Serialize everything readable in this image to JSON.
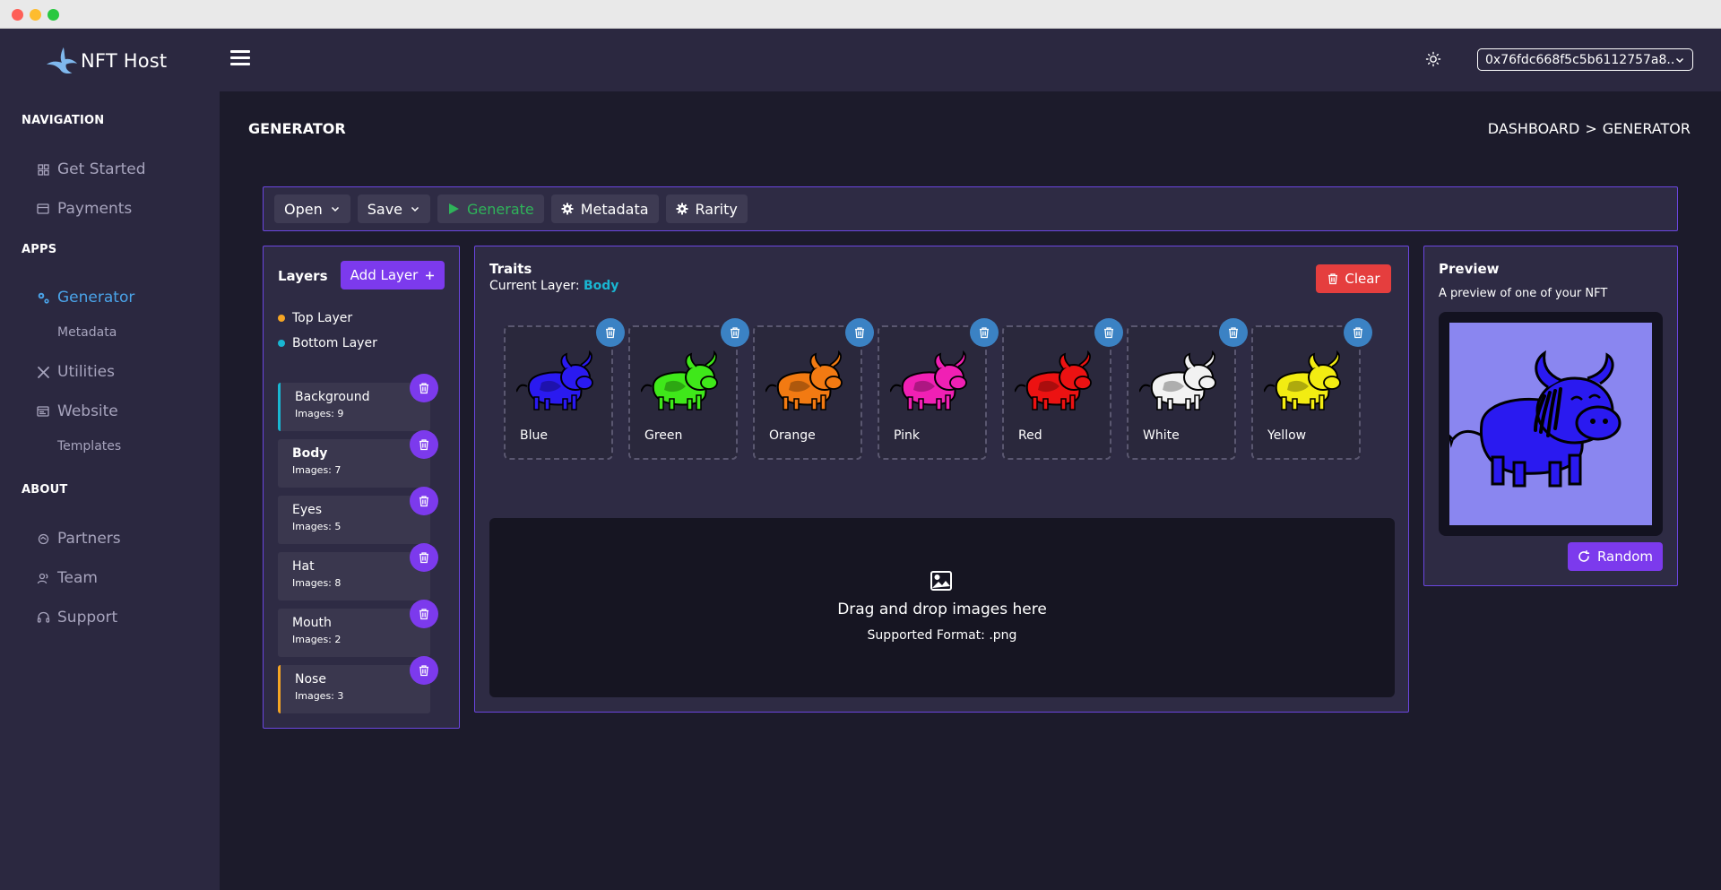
{
  "app": {
    "name": "NFT Host"
  },
  "window": {
    "buttons": [
      "close",
      "minimize",
      "maximize"
    ]
  },
  "sidebar": {
    "sections": {
      "navigation": "NAVIGATION",
      "apps": "APPS",
      "about": "ABOUT"
    },
    "items": {
      "get_started": "Get Started",
      "payments": "Payments",
      "generator": "Generator",
      "metadata": "Metadata",
      "utilities": "Utilities",
      "website": "Website",
      "templates": "Templates",
      "partners": "Partners",
      "team": "Team",
      "support": "Support"
    },
    "active_item": "Generator"
  },
  "topbar": {
    "wallet": "0x76fdc668f5c5b6112757a8..."
  },
  "header": {
    "title": "GENERATOR",
    "breadcrumb": [
      "DASHBOARD",
      ">",
      "GENERATOR"
    ]
  },
  "toolbar": {
    "open": "Open",
    "save": "Save",
    "generate": "Generate",
    "metadata": "Metadata",
    "rarity": "Rarity"
  },
  "layers": {
    "title": "Layers",
    "add_button": "Add Layer",
    "legend_top": "Top Layer",
    "legend_bottom": "Bottom Layer",
    "items": [
      {
        "name": "Background",
        "count": "Images: 9"
      },
      {
        "name": "Body",
        "count": "Images: 7"
      },
      {
        "name": "Eyes",
        "count": "Images: 5"
      },
      {
        "name": "Hat",
        "count": "Images: 8"
      },
      {
        "name": "Mouth",
        "count": "Images: 2"
      },
      {
        "name": "Nose",
        "count": "Images: 3"
      }
    ],
    "colors": {
      "top": "#f5a524",
      "bottom": "#19b6d2"
    }
  },
  "traits": {
    "title": "Traits",
    "current_layer_label": "Current Layer:",
    "current_layer_value": "Body",
    "clear_button": "Clear",
    "items": [
      {
        "name": "Blue",
        "color": "#2a1af0"
      },
      {
        "name": "Green",
        "color": "#3fe81a"
      },
      {
        "name": "Orange",
        "color": "#f27a12"
      },
      {
        "name": "Pink",
        "color": "#f020b4"
      },
      {
        "name": "Red",
        "color": "#ec1212"
      },
      {
        "name": "White",
        "color": "#f2f2f2"
      },
      {
        "name": "Yellow",
        "color": "#f2ec12"
      }
    ],
    "dropzone": {
      "title": "Drag and drop images here",
      "subtitle": "Supported Format: .png"
    }
  },
  "preview": {
    "title": "Preview",
    "description": "A preview of one of your NFT",
    "random_button": "Random"
  }
}
